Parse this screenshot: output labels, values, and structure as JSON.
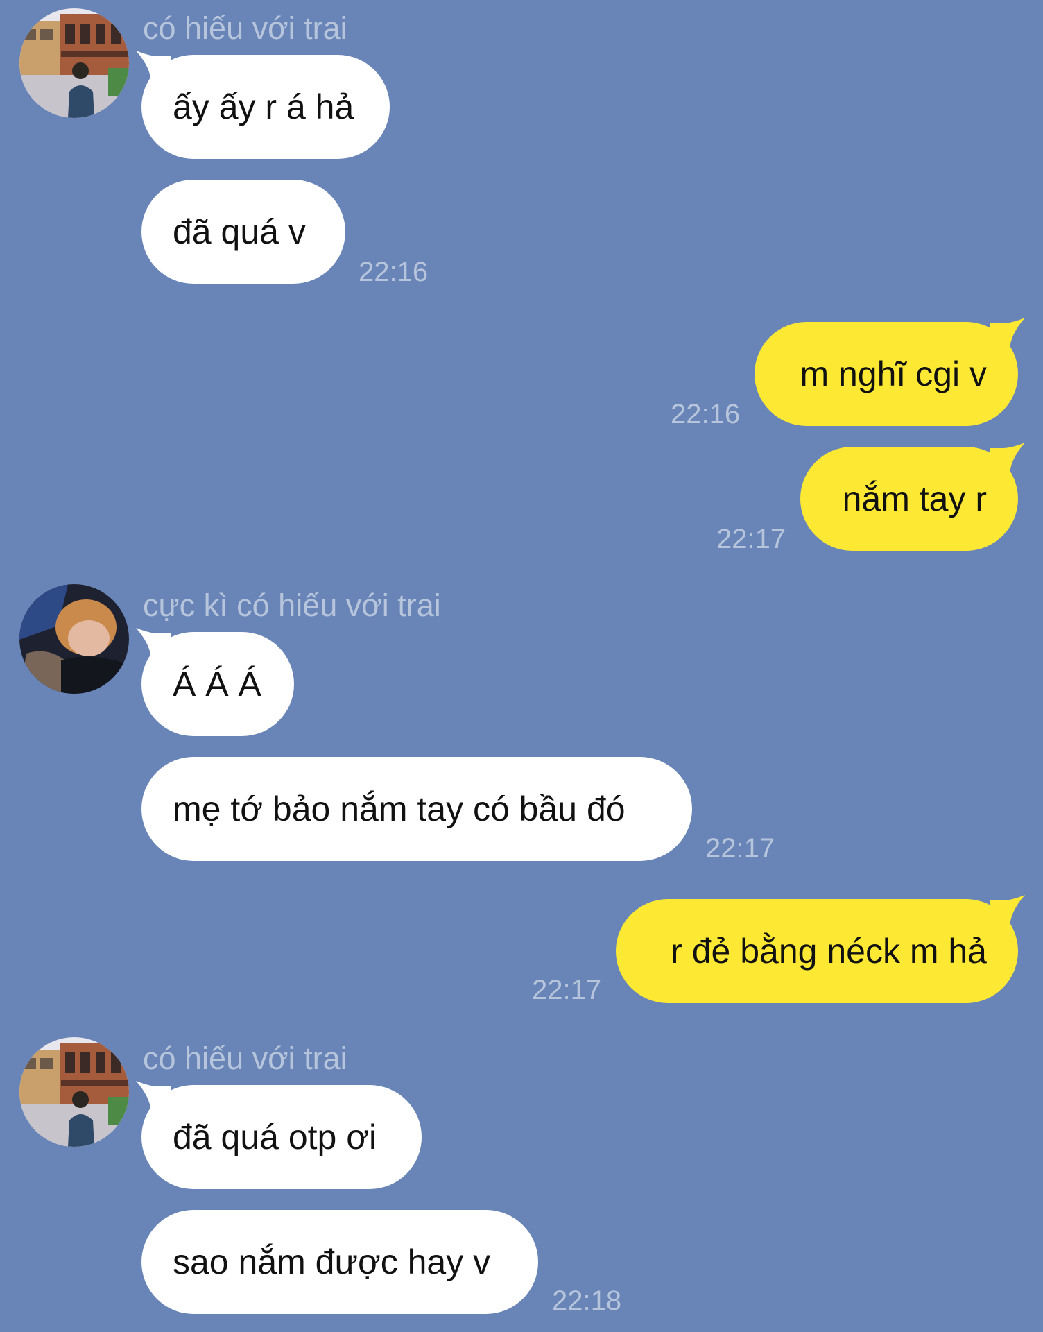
{
  "colors": {
    "background": "#6985b7",
    "incoming_bubble": "#ffffff",
    "outgoing_bubble": "#fde934",
    "meta_text": "#b7c5dc",
    "message_text": "#111111"
  },
  "messages": [
    {
      "direction": "in",
      "sender": "có hiếu với trai",
      "avatar": "avatar-street-photo",
      "text": "ấy ấy r á hả",
      "time": ""
    },
    {
      "direction": "in",
      "text": "đã quá v",
      "time": "22:16"
    },
    {
      "direction": "out",
      "text": "m nghĩ cgi v",
      "time": "22:16"
    },
    {
      "direction": "out",
      "text": "nắm tay r",
      "time": "22:17"
    },
    {
      "direction": "in",
      "sender": "cực kì có hiếu với trai",
      "avatar": "avatar-couple-photo",
      "text": "Á Á Á",
      "time": ""
    },
    {
      "direction": "in",
      "text": "mẹ tớ bảo nắm tay có bầu đó",
      "time": "22:17"
    },
    {
      "direction": "out",
      "text": "r đẻ bằng néck m hả",
      "time": "22:17"
    },
    {
      "direction": "in",
      "sender": "có hiếu với trai",
      "avatar": "avatar-street-photo",
      "text": "đã quá otp ơi",
      "time": ""
    },
    {
      "direction": "in",
      "text": "sao nắm được hay v",
      "time": "22:18"
    }
  ]
}
